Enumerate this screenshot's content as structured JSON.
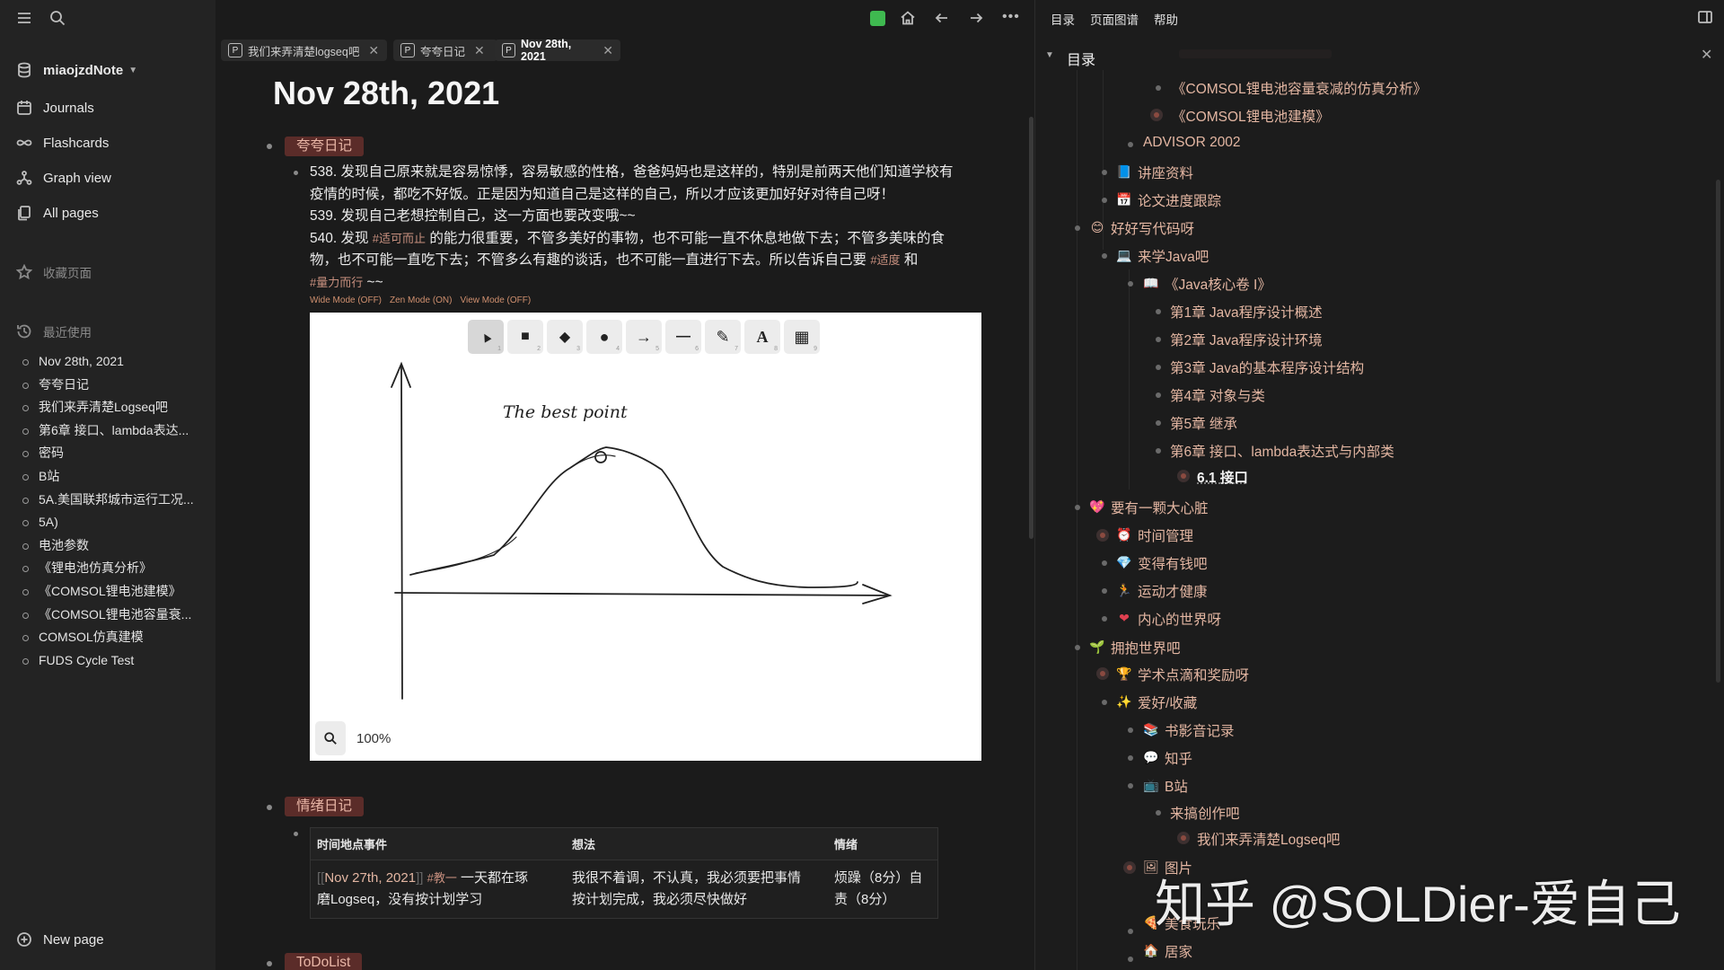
{
  "app": {
    "graph_name": "miaojzdNote",
    "accent_green": "#3fb950",
    "tag_bg": "#5b2c29",
    "link_color": "#e3b6a2"
  },
  "sidebar": {
    "nav": [
      {
        "label": "Journals",
        "icon": "calendar-icon"
      },
      {
        "label": "Flashcards",
        "icon": "infinity-icon"
      },
      {
        "label": "Graph view",
        "icon": "graph-icon"
      },
      {
        "label": "All pages",
        "icon": "pages-icon"
      }
    ],
    "favorites_label": "收藏页面",
    "recent_label": "最近使用",
    "recent": [
      "Nov 28th, 2021",
      "夸夸日记",
      "我们来弄清楚Logseq吧",
      "第6章 接口、lambda表达...",
      "密码",
      "B站",
      "5A.美国联邦城市运行工况...",
      "5A)",
      "电池参数",
      "《锂电池仿真分析》",
      "《COMSOL锂电池建模》",
      "《COMSOL锂电池容量衰...",
      "COMSOL仿真建模",
      "FUDS Cycle Test"
    ],
    "new_page_label": "New page"
  },
  "tabs": [
    {
      "badge": "P",
      "label": "我们来弄清楚logseq吧"
    },
    {
      "badge": "P",
      "label": "夸夸日记"
    },
    {
      "badge": "P",
      "label": "Nov 28th, 2021"
    }
  ],
  "page": {
    "title": "Nov 28th, 2021",
    "block1_tag": "夸夸日记",
    "line538a": "538. 发现自己原来就是容易惊悸，容易敏感的性格，爸爸妈妈也是这样的，特别是前两天他们知道学校有",
    "line538b": "疫情的时候，都吃不好饭。正是因为知道自己是这样的自己，所以才应该更加好好对待自己呀！",
    "line539": "539. 发现自己老想控制自己，这一方面也要改变哦~~",
    "line540_pre": "540. 发现 ",
    "tag_shike": "#适可而止",
    "line540_mid": " 的能力很重要，不管多美好的事物，也不可能一直不休息地做下去；不管多美味的食",
    "line540b_pre": "物，也不可能一直吃下去；不管多么有趣的谈话，也不可能一直进行下去。所以告诉自己要 ",
    "tag_shidu": "#适度",
    "line540b_post": " 和",
    "tag_liangli": "#量力而行",
    "line540c_post": " ~~",
    "modes": {
      "wide": "Wide Mode (OFF)",
      "zen": "Zen Mode (ON)",
      "view": "View Mode (OFF)"
    },
    "drawing": {
      "label": "The best point",
      "zoom": "100%",
      "tools": [
        "select-tool",
        "rectangle-tool",
        "diamond-tool",
        "ellipse-tool",
        "arrow-tool",
        "line-tool",
        "pencil-tool",
        "text-tool",
        "library-tool"
      ],
      "tool_glyphs": [
        "▲",
        "■",
        "◆",
        "●",
        "→",
        "—",
        "✎",
        "A",
        "▦"
      ],
      "tool_nums": [
        "1",
        "2",
        "3",
        "4",
        "5",
        "6",
        "7",
        "8",
        "9"
      ]
    },
    "block2_tag": "情绪日记",
    "table": {
      "headers": [
        "时间地点事件",
        "想法",
        "情绪"
      ],
      "row": {
        "date_link": "Nov 27th, 2021",
        "tag": "#教一",
        "event_a": " 一天都在琢",
        "event_b": "磨Logseq，没有按计划学习",
        "thought_a": "我很不着调，不认真，我必须要把事情",
        "thought_b": "按计划完成，我必须尽快做好",
        "emotion_a": "烦躁（8分）自",
        "emotion_b": "责（8分）"
      }
    },
    "block3_tag": "ToDoList"
  },
  "right": {
    "menu": [
      "目录",
      "页面图谱",
      "帮助"
    ],
    "toc_title": "目录",
    "items": [
      {
        "text": "《COMSOL锂电池容量衰减的仿真分析》",
        "emoji": ""
      },
      {
        "text": "《COMSOL锂电池建模》",
        "emoji": ""
      },
      {
        "text": "ADVISOR 2002",
        "emoji": ""
      },
      {
        "text": "讲座资料",
        "emoji": "📘"
      },
      {
        "text": "论文进度跟踪",
        "emoji": "📅"
      },
      {
        "text": "好好写代码呀",
        "emoji": "😊"
      },
      {
        "text": "来学Java吧",
        "emoji": "💻"
      },
      {
        "text": "《Java核心卷 I》",
        "emoji": "📖"
      },
      {
        "text": "第1章 Java程序设计概述",
        "emoji": ""
      },
      {
        "text": "第2章 Java程序设计环境",
        "emoji": ""
      },
      {
        "text": "第3章 Java的基本程序设计结构",
        "emoji": ""
      },
      {
        "text": "第4章 对象与类",
        "emoji": ""
      },
      {
        "text": "第5章 继承",
        "emoji": ""
      },
      {
        "text": "第6章 接口、lambda表达式与内部类",
        "emoji": ""
      },
      {
        "text": "6.1 接口",
        "emoji": ""
      },
      {
        "text": "要有一颗大心脏",
        "emoji": "💖"
      },
      {
        "text": "时间管理",
        "emoji": "⏰"
      },
      {
        "text": "变得有钱吧",
        "emoji": "💎"
      },
      {
        "text": "运动才健康",
        "emoji": "🏃"
      },
      {
        "text": "内心的世界呀",
        "emoji": "❤"
      },
      {
        "text": "拥抱世界吧",
        "emoji": "🌱"
      },
      {
        "text": "学术点滴和奖励呀",
        "emoji": "🏆"
      },
      {
        "text": "爱好/收藏",
        "emoji": "✨"
      },
      {
        "text": "书影音记录",
        "emoji": "📚"
      },
      {
        "text": "知乎",
        "emoji": "💬"
      },
      {
        "text": "B站",
        "emoji": "📺"
      },
      {
        "text": "来搞创作吧",
        "emoji": ""
      },
      {
        "text": "我们来弄清楚Logseq吧",
        "emoji": ""
      },
      {
        "text": "图片",
        "emoji": "🖼"
      },
      {
        "text": "美食玩乐",
        "emoji": "🍕"
      },
      {
        "text": "居家",
        "emoji": "🏠"
      }
    ],
    "watermark": "知乎 @SOLDier-爱自己"
  }
}
